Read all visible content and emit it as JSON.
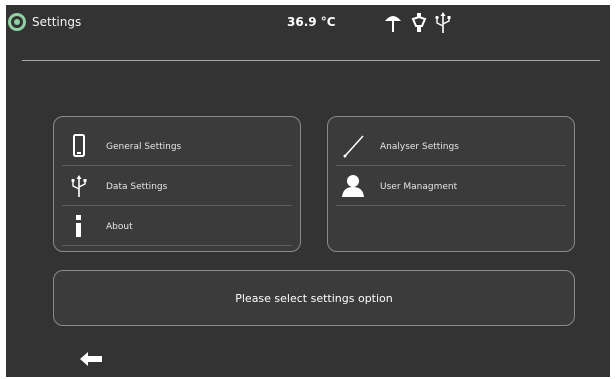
{
  "status_bar": {
    "title": "Settings",
    "temperature": "36.9 °C",
    "icons": [
      "sensor-probe-icon",
      "pen-sensor-icon",
      "usb-icon"
    ]
  },
  "panels": {
    "left": {
      "items": [
        {
          "label": "General Settings",
          "icon": "phone-icon"
        },
        {
          "label": "Data Settings",
          "icon": "usb-icon"
        },
        {
          "label": "About",
          "icon": "info-icon"
        }
      ]
    },
    "right": {
      "items": [
        {
          "label": "Analyser Settings",
          "icon": "stylus-icon"
        },
        {
          "label": "User Managment",
          "icon": "user-icon"
        }
      ]
    }
  },
  "message": {
    "text": "Please select settings option"
  },
  "navigation": {
    "back_icon": "back-arrow-icon"
  },
  "colors": {
    "background": "#333333",
    "panel": "#3b3b3b",
    "panel_border": "#8a8a8a",
    "text": "#f2f2f2",
    "logo_accent": "#8fd0a4"
  }
}
